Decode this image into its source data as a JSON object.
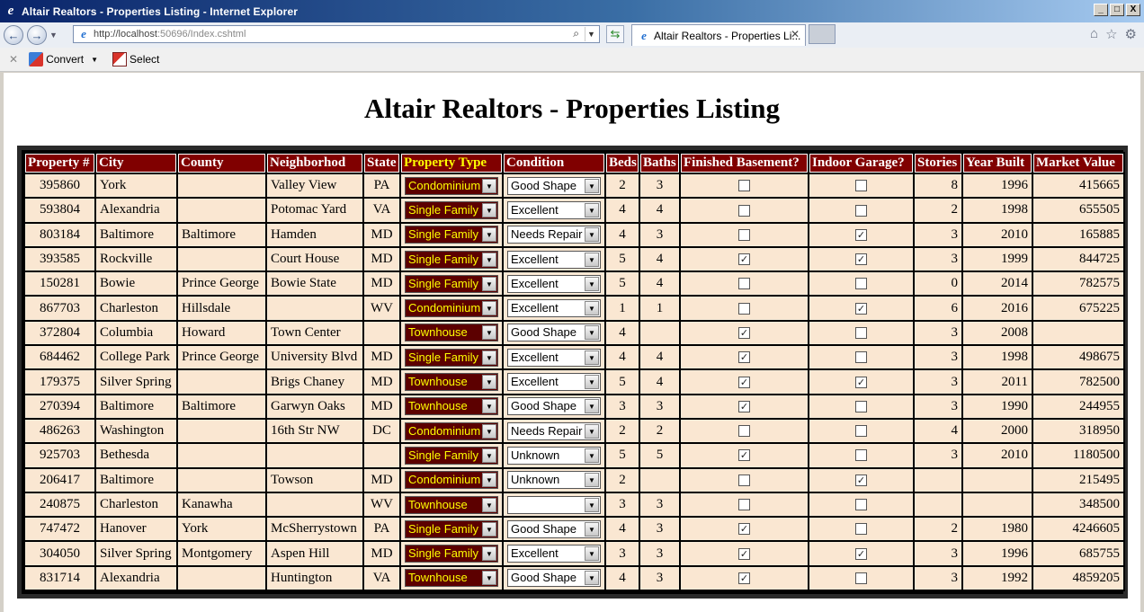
{
  "window": {
    "title": "Altair Realtors - Properties Listing - Internet Explorer",
    "minimize": "_",
    "maximize": "□",
    "close": "X"
  },
  "browser": {
    "url_host": "http://localhost",
    "url_rest": ":50696/Index.cshtml",
    "tab_title": "Altair Realtors - Properties Li...",
    "tab_close": "✕"
  },
  "commandbar": {
    "convert_label": "Convert",
    "select_label": "Select"
  },
  "page": {
    "heading": "Altair Realtors - Properties Listing"
  },
  "table": {
    "columns": [
      "Property #",
      "City",
      "County",
      "Neighborhod",
      "State",
      "Property Type",
      "Condition",
      "Beds",
      "Baths",
      "Finished Basement?",
      "Indoor Garage?",
      "Stories",
      "Year Built",
      "Market Value"
    ],
    "rows": [
      {
        "property_no": "395860",
        "city": "York",
        "county": "",
        "neighborhood": "Valley View",
        "state": "PA",
        "property_type": "Condominium",
        "condition": "Good Shape",
        "beds": "2",
        "baths": "3",
        "basement": false,
        "garage": false,
        "stories": "8",
        "year_built": "1996",
        "market_value": "415665"
      },
      {
        "property_no": "593804",
        "city": "Alexandria",
        "county": "",
        "neighborhood": "Potomac Yard",
        "state": "VA",
        "property_type": "Single Family",
        "condition": "Excellent",
        "beds": "4",
        "baths": "4",
        "basement": false,
        "garage": false,
        "stories": "2",
        "year_built": "1998",
        "market_value": "655505"
      },
      {
        "property_no": "803184",
        "city": "Baltimore",
        "county": "Baltimore",
        "neighborhood": "Hamden",
        "state": "MD",
        "property_type": "Single Family",
        "condition": "Needs Repair",
        "beds": "4",
        "baths": "3",
        "basement": false,
        "garage": true,
        "stories": "3",
        "year_built": "2010",
        "market_value": "165885"
      },
      {
        "property_no": "393585",
        "city": "Rockville",
        "county": "",
        "neighborhood": "Court House",
        "state": "MD",
        "property_type": "Single Family",
        "condition": "Excellent",
        "beds": "5",
        "baths": "4",
        "basement": true,
        "garage": true,
        "stories": "3",
        "year_built": "1999",
        "market_value": "844725"
      },
      {
        "property_no": "150281",
        "city": "Bowie",
        "county": "Prince George",
        "neighborhood": "Bowie State",
        "state": "MD",
        "property_type": "Single Family",
        "condition": "Excellent",
        "beds": "5",
        "baths": "4",
        "basement": false,
        "garage": false,
        "stories": "0",
        "year_built": "2014",
        "market_value": "782575"
      },
      {
        "property_no": "867703",
        "city": "Charleston",
        "county": "Hillsdale",
        "neighborhood": "",
        "state": "WV",
        "property_type": "Condominium",
        "condition": "Excellent",
        "beds": "1",
        "baths": "1",
        "basement": false,
        "garage": true,
        "stories": "6",
        "year_built": "2016",
        "market_value": "675225"
      },
      {
        "property_no": "372804",
        "city": "Columbia",
        "county": "Howard",
        "neighborhood": "Town Center",
        "state": "",
        "property_type": "Townhouse",
        "condition": "Good Shape",
        "beds": "4",
        "baths": "",
        "basement": true,
        "garage": false,
        "stories": "3",
        "year_built": "2008",
        "market_value": ""
      },
      {
        "property_no": "684462",
        "city": "College Park",
        "county": "Prince George",
        "neighborhood": "University Blvd",
        "state": "MD",
        "property_type": "Single Family",
        "condition": "Excellent",
        "beds": "4",
        "baths": "4",
        "basement": true,
        "garage": false,
        "stories": "3",
        "year_built": "1998",
        "market_value": "498675"
      },
      {
        "property_no": "179375",
        "city": "Silver Spring",
        "county": "",
        "neighborhood": "Brigs Chaney",
        "state": "MD",
        "property_type": "Townhouse",
        "condition": "Excellent",
        "beds": "5",
        "baths": "4",
        "basement": true,
        "garage": true,
        "stories": "3",
        "year_built": "2011",
        "market_value": "782500"
      },
      {
        "property_no": "270394",
        "city": "Baltimore",
        "county": "Baltimore",
        "neighborhood": "Garwyn Oaks",
        "state": "MD",
        "property_type": "Townhouse",
        "condition": "Good Shape",
        "beds": "3",
        "baths": "3",
        "basement": true,
        "garage": false,
        "stories": "3",
        "year_built": "1990",
        "market_value": "244955"
      },
      {
        "property_no": "486263",
        "city": "Washington",
        "county": "",
        "neighborhood": "16th Str NW",
        "state": "DC",
        "property_type": "Condominium",
        "condition": "Needs Repair",
        "beds": "2",
        "baths": "2",
        "basement": false,
        "garage": false,
        "stories": "4",
        "year_built": "2000",
        "market_value": "318950"
      },
      {
        "property_no": "925703",
        "city": "Bethesda",
        "county": "",
        "neighborhood": "",
        "state": "",
        "property_type": "Single Family",
        "condition": "Unknown",
        "beds": "5",
        "baths": "5",
        "basement": true,
        "garage": false,
        "stories": "3",
        "year_built": "2010",
        "market_value": "1180500"
      },
      {
        "property_no": "206417",
        "city": "Baltimore",
        "county": "",
        "neighborhood": "Towson",
        "state": "MD",
        "property_type": "Condominium",
        "condition": "Unknown",
        "beds": "2",
        "baths": "",
        "basement": false,
        "garage": true,
        "stories": "",
        "year_built": "",
        "market_value": "215495"
      },
      {
        "property_no": "240875",
        "city": "Charleston",
        "county": "Kanawha",
        "neighborhood": "",
        "state": "WV",
        "property_type": "Townhouse",
        "condition": "",
        "beds": "3",
        "baths": "3",
        "basement": false,
        "garage": false,
        "stories": "",
        "year_built": "",
        "market_value": "348500"
      },
      {
        "property_no": "747472",
        "city": "Hanover",
        "county": "York",
        "neighborhood": "McSherrystown",
        "state": "PA",
        "property_type": "Single Family",
        "condition": "Good Shape",
        "beds": "4",
        "baths": "3",
        "basement": true,
        "garage": false,
        "stories": "2",
        "year_built": "1980",
        "market_value": "4246605"
      },
      {
        "property_no": "304050",
        "city": "Silver Spring",
        "county": "Montgomery",
        "neighborhood": "Aspen Hill",
        "state": "MD",
        "property_type": "Single Family",
        "condition": "Excellent",
        "beds": "3",
        "baths": "3",
        "basement": true,
        "garage": true,
        "stories": "3",
        "year_built": "1996",
        "market_value": "685755"
      },
      {
        "property_no": "831714",
        "city": "Alexandria",
        "county": "",
        "neighborhood": "Huntington",
        "state": "VA",
        "property_type": "Townhouse",
        "condition": "Good Shape",
        "beds": "4",
        "baths": "3",
        "basement": true,
        "garage": false,
        "stories": "3",
        "year_built": "1992",
        "market_value": "4859205"
      }
    ]
  },
  "colors": {
    "header_bg": "#800000",
    "header_highlight": "#ffff00",
    "cell_bg": "#fae7d2",
    "type_select_bg": "#5c0000"
  }
}
